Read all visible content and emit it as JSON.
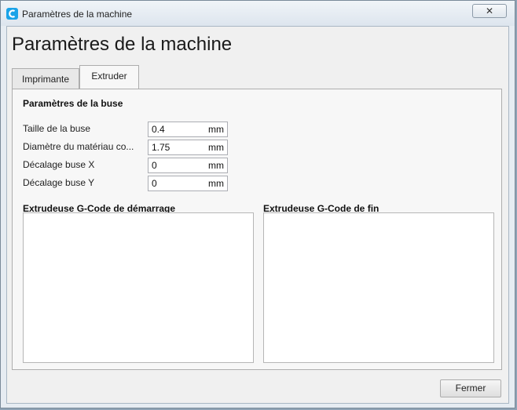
{
  "window": {
    "title": "Paramètres de la machine",
    "close_label": "✕"
  },
  "dialog": {
    "heading": "Paramètres de la machine"
  },
  "tabs": [
    {
      "label": "Imprimante",
      "active": false
    },
    {
      "label": "Extruder",
      "active": true
    }
  ],
  "nozzle": {
    "section_title": "Paramètres de la buse",
    "fields": [
      {
        "label": "Taille de la buse",
        "value": "0.4",
        "unit": "mm"
      },
      {
        "label": "Diamètre du matériau co...",
        "value": "1.75",
        "unit": "mm"
      },
      {
        "label": "Décalage buse X",
        "value": "0",
        "unit": "mm"
      },
      {
        "label": "Décalage buse Y",
        "value": "0",
        "unit": "mm"
      }
    ]
  },
  "gcode": {
    "start_title": "Extrudeuse G-Code de démarrage",
    "start_value": "",
    "end_title": "Extrudeuse G-Code de fin",
    "end_value": ""
  },
  "footer": {
    "close_button": "Fermer"
  },
  "icons": {
    "app": "cura-app-icon",
    "close": "close-icon"
  },
  "colors": {
    "app_icon": "#1aa3e8"
  }
}
